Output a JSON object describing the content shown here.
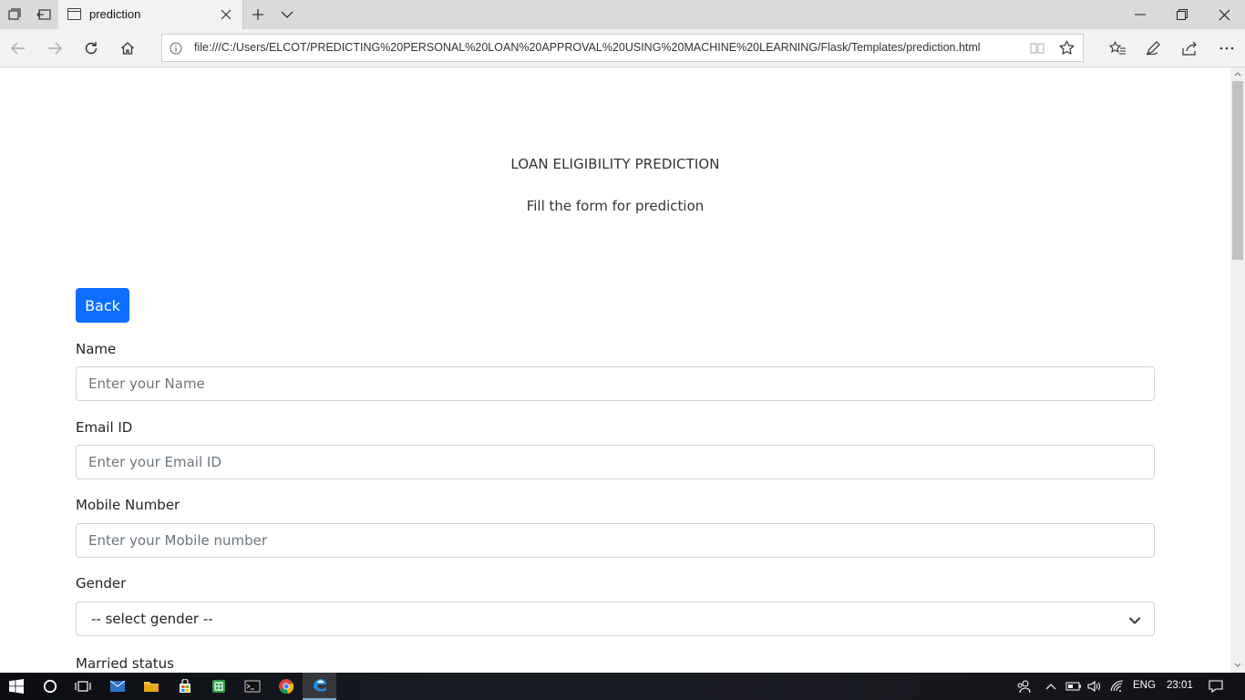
{
  "browser": {
    "tab_title": "prediction",
    "url": "file:///C:/Users/ELCOT/PREDICTING%20PERSONAL%20LOAN%20APPROVAL%20USING%20MACHINE%20LEARNING/Flask/Templates/prediction.html"
  },
  "page": {
    "heading": "LOAN ELIGIBILITY PREDICTION",
    "subheading": "Fill the form for prediction",
    "back_label": "Back",
    "fields": [
      {
        "label": "Name",
        "placeholder": "Enter your Name"
      },
      {
        "label": "Email ID",
        "placeholder": "Enter your Email ID"
      },
      {
        "label": "Mobile Number",
        "placeholder": "Enter your Mobile number"
      }
    ],
    "gender": {
      "label": "Gender",
      "selected": "-- select gender --"
    },
    "married": {
      "label": "Married status"
    },
    "accent_color": "#0d6efd"
  },
  "taskbar": {
    "language": "ENG",
    "time": "23:01"
  }
}
